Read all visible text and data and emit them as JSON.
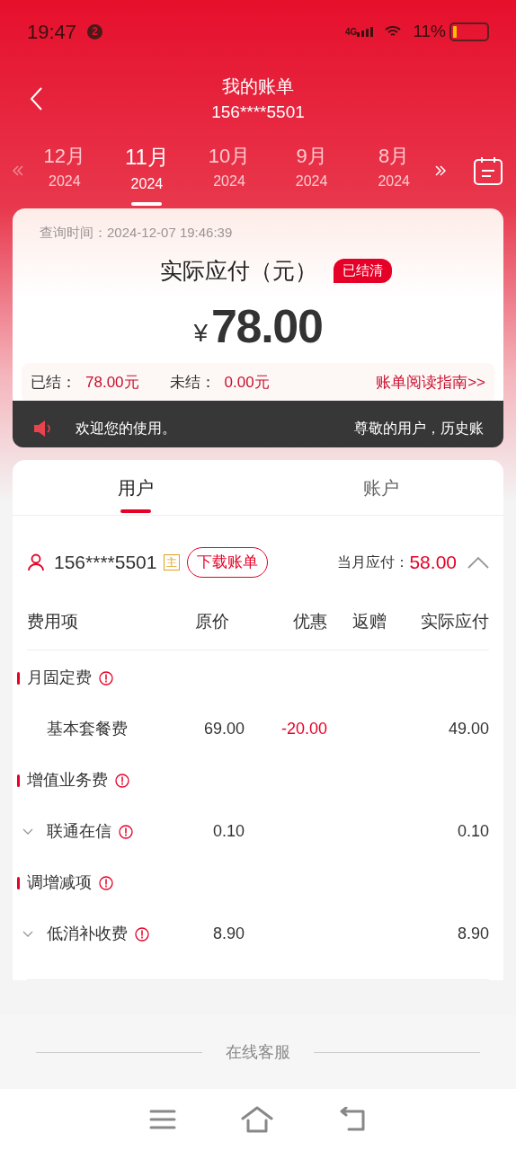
{
  "status_bar": {
    "time": "19:47",
    "notification_count": "2",
    "network": "4G",
    "battery": "11%"
  },
  "header": {
    "title": "我的账单",
    "subtitle": "156****5501"
  },
  "months": [
    {
      "month": "12月",
      "year": "2024",
      "selected": false
    },
    {
      "month": "11月",
      "year": "2024",
      "selected": true
    },
    {
      "month": "10月",
      "year": "2024",
      "selected": false
    },
    {
      "month": "9月",
      "year": "2024",
      "selected": false
    },
    {
      "month": "8月",
      "year": "2024",
      "selected": false
    }
  ],
  "summary": {
    "query_time": "查询时间：2024-12-07 19:46:39",
    "title": "实际应付（元）",
    "badge": "已结清",
    "currency": "¥",
    "amount": "78.00",
    "settled_label": "已结：",
    "settled": "78.00元",
    "unsettled_label": "未结：",
    "unsettled": "0.00元",
    "guide": "账单阅读指南>>"
  },
  "notice": {
    "left": "欢迎您的使用。",
    "right": "尊敬的用户，历史账"
  },
  "tabs": [
    {
      "label": "用户",
      "selected": true
    },
    {
      "label": "账户",
      "selected": false
    }
  ],
  "account": {
    "number": "156****5501",
    "main_tag": "主",
    "download": "下载账单",
    "due_label": "当月应付：",
    "due": "58.00",
    "expanded": true
  },
  "columns": [
    "费用项",
    "原价",
    "优惠",
    "返赠",
    "实际应付"
  ],
  "rows": [
    {
      "kind": "section",
      "label": "月固定费"
    },
    {
      "kind": "item",
      "label": "基本套餐费",
      "expandable": false,
      "info": false,
      "original": "69.00",
      "discount": "-20.00",
      "actual": "49.00"
    },
    {
      "kind": "section",
      "label": "增值业务费"
    },
    {
      "kind": "item",
      "label": "联通在信",
      "expandable": true,
      "info": true,
      "original": "0.10",
      "actual": "0.10"
    },
    {
      "kind": "section",
      "label": "调增减项"
    },
    {
      "kind": "item",
      "label": "低消补收费",
      "expandable": true,
      "info": true,
      "original": "8.90",
      "actual": "8.90"
    }
  ],
  "service": {
    "label": "在线客服"
  }
}
